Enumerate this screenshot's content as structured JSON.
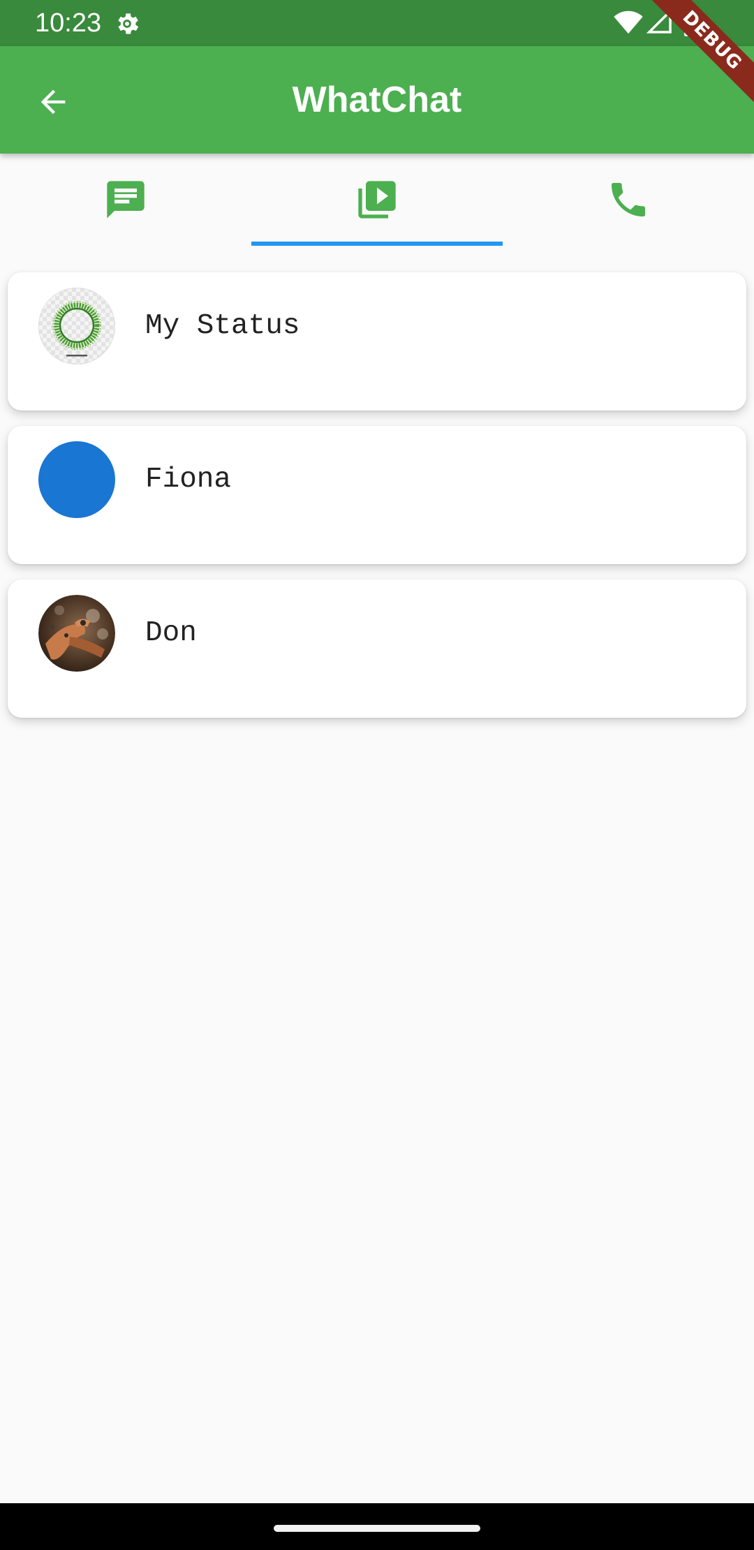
{
  "status_bar": {
    "time": "10:23",
    "icons": [
      "settings-gear-icon",
      "wifi-icon",
      "cell-signal-icon",
      "battery-icon"
    ]
  },
  "app_bar": {
    "title": "WhatChat",
    "back_icon": "arrow-back-icon",
    "color": "#4caf50"
  },
  "debug_banner": {
    "label": "DEBUG"
  },
  "tabs": [
    {
      "icon": "chat-message-icon",
      "selected": false
    },
    {
      "icon": "video-library-icon",
      "selected": true
    },
    {
      "icon": "phone-icon",
      "selected": false
    }
  ],
  "statuses": [
    {
      "name": "My Status",
      "avatar": "green-ring-avatar"
    },
    {
      "name": "Fiona",
      "avatar": "blue-circle-avatar"
    },
    {
      "name": "Don",
      "avatar": "photo-avatar"
    }
  ],
  "colors": {
    "status_bar": "#398a3c",
    "accent": "#4caf50",
    "tab_indicator": "#2196f3",
    "fiona_avatar": "#1976d2"
  }
}
